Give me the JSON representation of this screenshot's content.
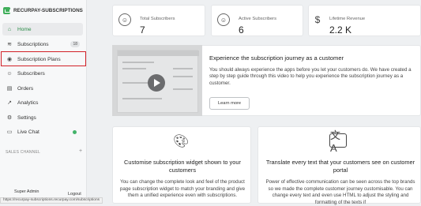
{
  "app": {
    "title": "RECURPAY-SUBSCRIPTIONS"
  },
  "nav": {
    "home": "Home",
    "subscriptions": "Subscriptions",
    "subscriptions_count": "18",
    "subscription_plans": "Subscription Plans",
    "subscribers": "Subscribers",
    "orders": "Orders",
    "analytics": "Analytics",
    "settings": "Settings",
    "live_chat": "Live Chat"
  },
  "sales_channel": {
    "label": "SALES CHANNEL",
    "add": "+"
  },
  "user": {
    "name": "Super Admin",
    "logout": "Logout"
  },
  "status_url": "https://recurpay-subscriptions.recurpay.com/subscriptions",
  "stats": [
    {
      "label": "Total Subscribers",
      "value": "7",
      "icon": "user-icon"
    },
    {
      "label": "Active Subscribers",
      "value": "6",
      "icon": "user-icon"
    },
    {
      "label": "Lifetime Revenue",
      "value": "2.2 K",
      "icon": "dollar-icon"
    }
  ],
  "journey": {
    "title": "Experience the subscription journey as a customer",
    "description": "You should always experience the apps before you let your customers do. We have created a step by step guide through this video to help you experience the subscription journey as a customer.",
    "button": "Learn more"
  },
  "features": [
    {
      "title": "Customise subscription widget shown to your customers",
      "description": "You can change the complete look and feel of the product page subscription widget to match your branding and give them a unified experience even with subscriptions.",
      "icon": "palette-icon"
    },
    {
      "title": "Translate every text that your customers see on customer portal",
      "description": "Power of effective communication can be seen across the top brands so we made the complete customer journey customisable. You can change every text and even use HTML to adjust the styling and formatting of the texts if",
      "icon": "translate-icon"
    }
  ],
  "colors": {
    "accent": "#2a8c47",
    "highlight": "#d22027",
    "online": "#43b36a"
  }
}
